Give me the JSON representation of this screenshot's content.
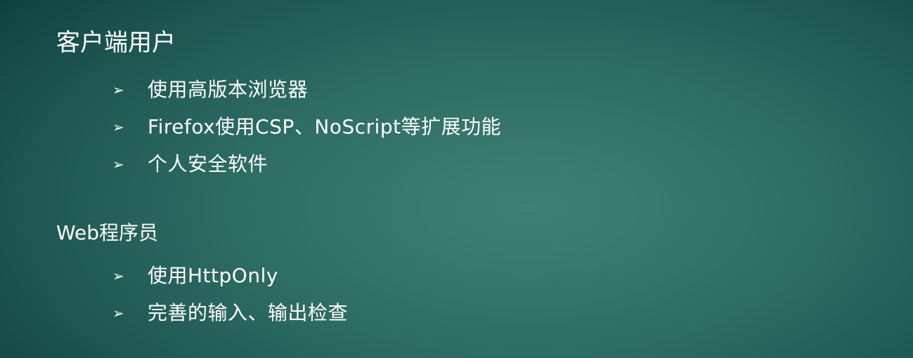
{
  "sections": [
    {
      "title": "客户端用户",
      "items": [
        {
          "icon": "arrow-bullet-icon",
          "text": "使用高版本浏览器"
        },
        {
          "icon": "arrow-bullet-icon",
          "text": "Firefox使用CSP、NoScript等扩展功能"
        },
        {
          "icon": "arrow-bullet-icon",
          "text": "个人安全软件"
        }
      ]
    },
    {
      "title": "Web程序员",
      "items": [
        {
          "icon": "arrow-bullet-icon",
          "text": "使用HttpOnly"
        },
        {
          "icon": "arrow-bullet-icon",
          "text": "完善的输入、输出检查"
        }
      ]
    }
  ],
  "colors": {
    "text": "#ffffff",
    "background_center": "#3f8074",
    "background_edge": "#0f3f40"
  }
}
